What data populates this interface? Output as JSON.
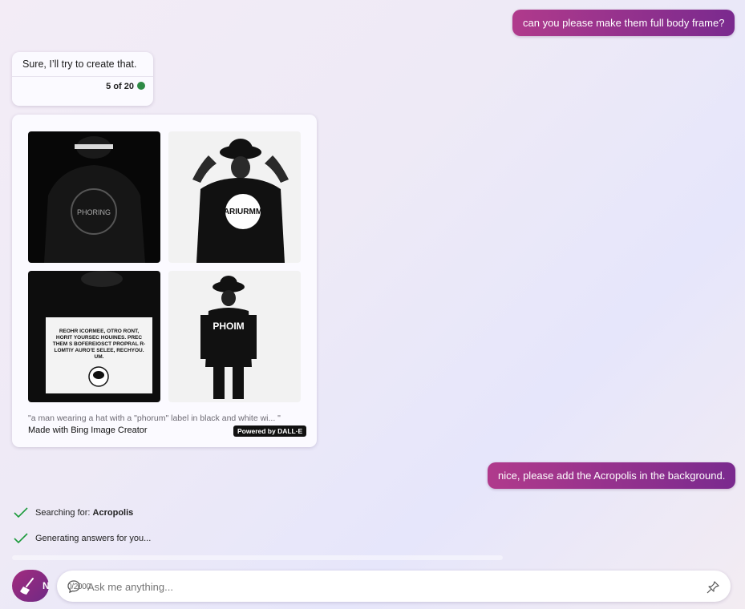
{
  "chat": {
    "user_msg_1": "can you please make them full body frame?",
    "bot_reply": "Sure, I’ll try to create that.",
    "counter": "5 of 20",
    "user_msg_2": "nice, please add the Acropolis in the background."
  },
  "images": {
    "caption": "\"a man wearing a hat with a \"phorum\" label in black and white wi... \"",
    "made_with": "Made with Bing Image Creator",
    "powered_by": "Powered by DALL·E",
    "tile1_text": "PHORING",
    "tile2_text": "ARIURMM",
    "tile3_text": "REOHR ICORMEE, OTRO RONT, HORIT YOURSEC HOUINES. PREC THEM S BOFEREIOSCT PROPRAL R- LOMTIY AURO'E SELEE, RECHYOU. UM.",
    "tile4_text": "PHOIM"
  },
  "status": {
    "searching_prefix": "Searching for: ",
    "searching_term": "Acropolis",
    "generating": "Generating answers for you..."
  },
  "input": {
    "placeholder": "Ask me anything...",
    "counter_overlay": "0/2000",
    "new_topic_letter": "N"
  },
  "colors": {
    "accent_start": "#b03a8c",
    "accent_end": "#7a2a8e",
    "status_green": "#2e8a45",
    "check_green": "#1a9a3a"
  },
  "icons": {
    "broom": "broom-icon",
    "chat": "chat-icon",
    "pin": "pin-icon",
    "check": "check-icon",
    "status_dot": "status-dot"
  }
}
